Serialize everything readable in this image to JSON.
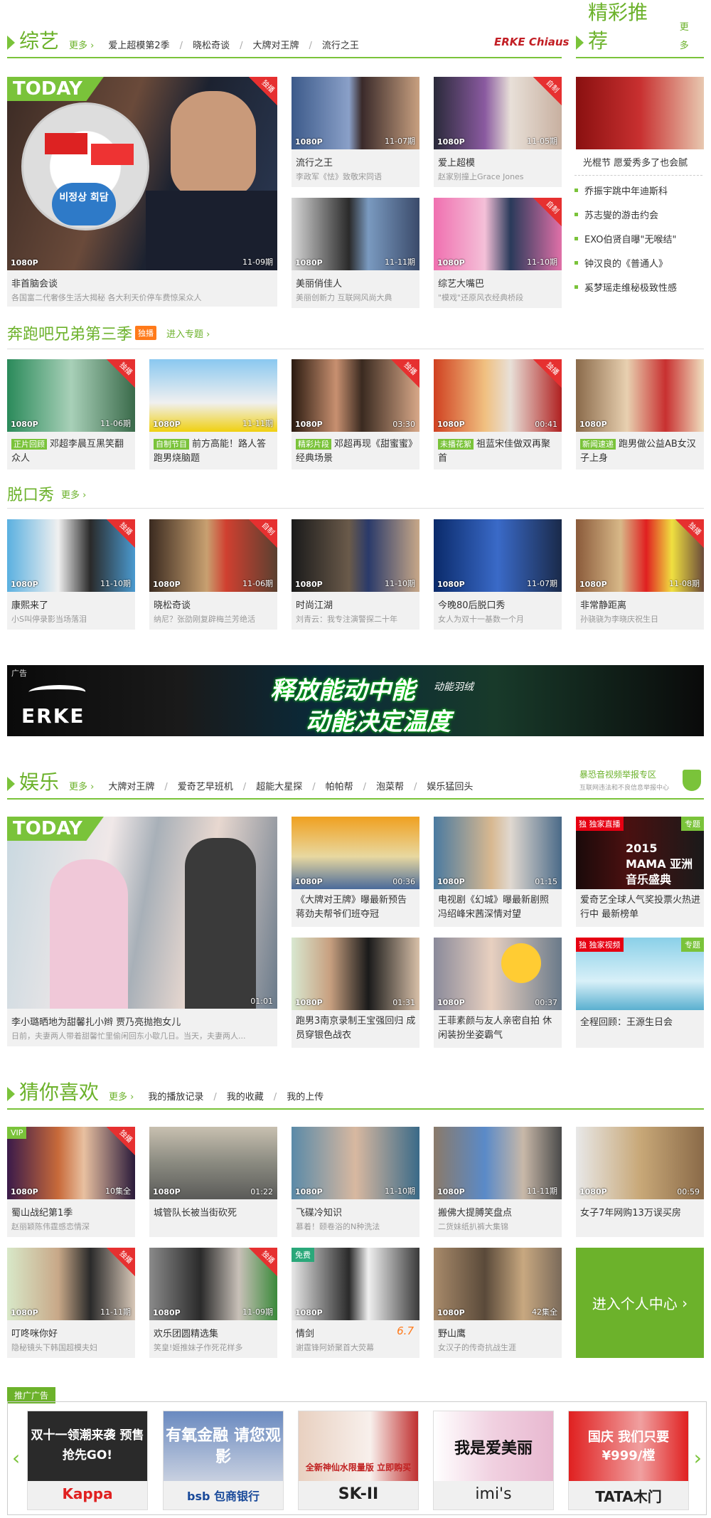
{
  "zongyi": {
    "title": "综艺",
    "more": "更多",
    "nav": [
      "爱上超模第2季",
      "晓松奇谈",
      "大牌对王牌",
      "流行之王"
    ],
    "sponsor": "ERKE Chiaus",
    "big": {
      "today": "TODAY",
      "badge": "1080P",
      "date": "11-09期",
      "corner": "独播",
      "title": "非首脑会谈",
      "sub": "各国富二代奢侈生活大揭秘 各大利天价停车费惊呆众人",
      "stamp": "비정상 회담"
    },
    "cards": [
      {
        "badge": "1080P",
        "date": "11-07期",
        "title": "流行之王",
        "sub": "李政军《怯》致敬宋同语"
      },
      {
        "badge": "1080P",
        "date": "11-05期",
        "title": "爱上超模",
        "sub": "赵家别撞上Grace Jones",
        "corner": "自制"
      },
      {
        "badge": "1080P",
        "date": "11-11期",
        "title": "美丽俏佳人",
        "sub": "美丽创新力 互联网风尚大典"
      },
      {
        "badge": "1080P",
        "date": "11-10期",
        "title": "综艺大嘴巴",
        "sub": "\"模戏\"还原风衣经典桥段",
        "corner": "自制"
      }
    ]
  },
  "recommend": {
    "title": "精彩推荐",
    "more": "更多",
    "top_title": "光棍节 愿爱秀多了也会腻",
    "items": [
      "乔振宇跳中年迪斯科",
      "苏志燮的游击约会",
      "EXO伯贤自曝\"无喉结\"",
      "钟汉良的《普通人》",
      "奚梦瑶走维秘极致性感"
    ]
  },
  "running": {
    "title": "奔跑吧兄弟第三季",
    "tag": "独播",
    "more": "进入专题",
    "cards": [
      {
        "badge": "1080P",
        "date": "11-06期",
        "tag": "正片回顾",
        "title": "邓超李晨互黑笑翻众人",
        "corner": "独播"
      },
      {
        "badge": "1080P",
        "date": "11-11期",
        "tag": "自制节目",
        "title": "前方高能！路人答跑男烧脑题"
      },
      {
        "badge": "1080P",
        "date": "03:30",
        "tag": "精彩片段",
        "title": "邓超再现《甜蜜蜜》经典场景",
        "corner": "独播"
      },
      {
        "badge": "1080P",
        "date": "00:41",
        "tag": "未播花絮",
        "title": "祖蓝宋佳做双再聚首",
        "corner": "独播"
      },
      {
        "badge": "1080P",
        "date": "",
        "tag": "新闻速递",
        "title": "跑男做公益AB女汉子上身"
      }
    ]
  },
  "talkshow": {
    "title": "脱口秀",
    "more": "更多",
    "cards": [
      {
        "badge": "1080P",
        "date": "11-10期",
        "title": "康熙来了",
        "sub": "小S叫停录影当场落泪",
        "corner": "独播"
      },
      {
        "badge": "1080P",
        "date": "11-06期",
        "title": "晓松奇谈",
        "sub": "纳尼？张劭刚复辟梅兰芳绝活",
        "corner": "自制"
      },
      {
        "badge": "1080P",
        "date": "11-10期",
        "title": "时尚江湖",
        "sub": "刘青云：我专注演警探二十年"
      },
      {
        "badge": "1080P",
        "date": "11-07期",
        "title": "今晚80后脱口秀",
        "sub": "女人为双十一基数一个月"
      },
      {
        "badge": "1080P",
        "date": "11-08期",
        "title": "非常静距离",
        "sub": "孙骁骁为李晓庆祝生日",
        "corner": "独播"
      }
    ]
  },
  "ad_banner": {
    "label": "广告",
    "brand": "ERKE",
    "slogan1": "释放能动中能",
    "slogan2": "动能决定温度",
    "sub": "动能羽绒"
  },
  "yule": {
    "title": "娱乐",
    "more": "更多",
    "nav": [
      "大牌对王牌",
      "爱奇艺早班机",
      "超能大星探",
      "帕帕帮",
      "泡菜帮",
      "娱乐猛回头"
    ],
    "report": "暴恐音视频举报专区",
    "report_sub": "互联网违法和不良信息举报中心",
    "big": {
      "today": "TODAY",
      "date": "01:01",
      "title": "李小璐晒地为甜馨扎小辫 贾乃亮抛抱女儿",
      "sub": "日前，夫妻两人带着甜馨忙里偷闲回东小歇几日。当天，夫妻两人..."
    },
    "cards": [
      {
        "badge": "1080P",
        "date": "00:36",
        "title": "《大牌对王牌》曝最新预告 蒋劲夫帮爷们班夺冠"
      },
      {
        "badge": "1080P",
        "date": "01:15",
        "title": "电视剧《幻城》曝最新剧照 冯绍峰宋茜深情对望"
      },
      {
        "badge": "1080P",
        "date": "01:31",
        "title": "跑男3南京录制王宝强回归 成员穿银色战衣"
      },
      {
        "badge": "1080P",
        "date": "00:37",
        "title": "王菲素颜与友人亲密自拍 休闲装扮坐姿霸气"
      }
    ],
    "special": [
      {
        "tag": "独家直播",
        "label": "专题",
        "title": "爱奇艺全球人气奖投票火热进行中 最新榜单",
        "img": "2015 MAMA 亚洲音乐盛典"
      },
      {
        "tag": "独家视频",
        "label": "专题",
        "title": "全程回顾：王源生日会"
      }
    ]
  },
  "guess": {
    "title": "猜你喜欢",
    "more": "更多",
    "nav": [
      "我的播放记录",
      "我的收藏",
      "我的上传"
    ],
    "cards": [
      {
        "badge": "1080P",
        "date": "10集全",
        "title": "蜀山战纪第1季",
        "sub": "赵丽颖陈伟霆感恋情深",
        "corner": "独播",
        "vip": "VIP"
      },
      {
        "badge": "1080P",
        "date": "01:22",
        "title": "城管队长被当街砍死",
        "sub": ""
      },
      {
        "badge": "1080P",
        "date": "11-10期",
        "title": "飞碟冷知识",
        "sub": "慕着！颐卷浴的N种洗法"
      },
      {
        "badge": "1080P",
        "date": "11-11期",
        "title": "搬佛大提膊笑盘点",
        "sub": "二货妹纸扒裤大集锦"
      },
      {
        "badge": "1080P",
        "date": "00:59",
        "title": "女子7年网购13万误买房",
        "sub": ""
      },
      {
        "badge": "1080P",
        "date": "11-11期",
        "title": "叮咚咪你好",
        "sub": "隐秘镜头下韩国超模夫妇",
        "corner": "独播"
      },
      {
        "badge": "1080P",
        "date": "11-09期",
        "title": "欢乐团圆精选集",
        "sub": "笑皇!姬推妹子作死花样多",
        "corner": "独播"
      },
      {
        "badge": "1080P",
        "date": "",
        "title": "情剑",
        "sub": "谢霆锋阿娇聚首大荧幕",
        "score": "6.7",
        "free": "免费"
      },
      {
        "badge": "1080P",
        "date": "42集全",
        "title": "野山鹰",
        "sub": "女汉子的传奇抗战生涯"
      }
    ],
    "personal": "进入个人中心"
  },
  "promo": {
    "label": "推广广告",
    "items": [
      {
        "top": "双十一领潮来袭 预售抢先GO!",
        "brand": "Kappa"
      },
      {
        "top": "有氧金融 请您观影",
        "brand": "bsb 包商银行"
      },
      {
        "top": "全新神仙水限量版 立即购买",
        "brand": "SK-II"
      },
      {
        "top": "我是爱美丽",
        "brand": "imi's"
      },
      {
        "top": "国庆 我们只要 ¥999/樘",
        "brand": "TATA木门"
      }
    ]
  },
  "colors": {
    "accent": "#7ac33a",
    "red": "#e63030"
  }
}
